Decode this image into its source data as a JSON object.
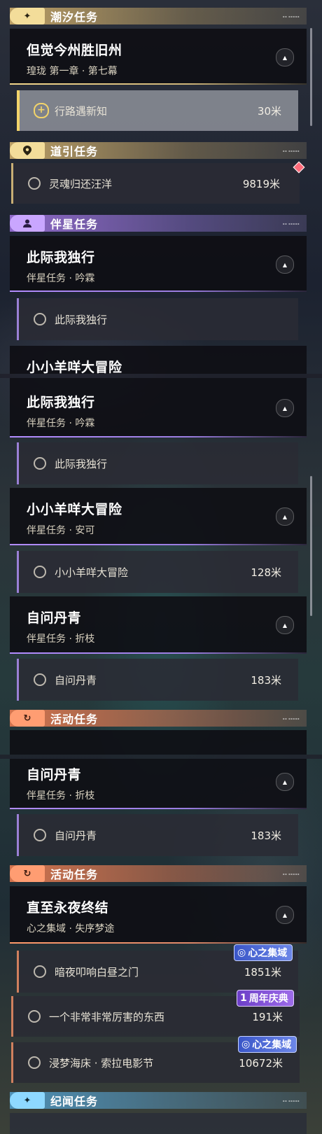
{
  "seg1": {
    "tide_header": "潮汐任务",
    "tide_card": {
      "title": "但觉今州胜旧州",
      "subtitle": "瑝珑 第一章 · 第七幕"
    },
    "tide_sub": {
      "label": "行路遇新知",
      "distance": "30米"
    },
    "guide_header": "道引任务",
    "guide_sub": {
      "label": "灵魂归还汪洋",
      "distance": "9819米"
    },
    "companion_header": "伴星任务",
    "companion_card": {
      "title": "此际我独行",
      "subtitle": "伴星任务 · 吟霖"
    },
    "companion_sub": {
      "label": "此际我独行"
    },
    "partial_title": "小小羊咩大冒险"
  },
  "seg2": {
    "card1": {
      "title": "此际我独行",
      "subtitle": "伴星任务 · 吟霖"
    },
    "sub1": {
      "label": "此际我独行"
    },
    "card2": {
      "title": "小小羊咩大冒险",
      "subtitle": "伴星任务 · 安可"
    },
    "sub2": {
      "label": "小小羊咩大冒险",
      "distance": "128米"
    },
    "card3": {
      "title": "自问丹青",
      "subtitle": "伴星任务 · 折枝"
    },
    "sub3": {
      "label": "自问丹青",
      "distance": "183米"
    },
    "event_header": "活动任务"
  },
  "seg3": {
    "card1": {
      "title": "自问丹青",
      "subtitle": "伴星任务 · 折枝"
    },
    "sub1": {
      "label": "自问丹青",
      "distance": "183米"
    },
    "event_header": "活动任务",
    "event_card": {
      "title": "直至永夜终结",
      "subtitle": "心之集域 · 失序梦途"
    },
    "event_sub1": {
      "label": "暗夜叩响白昼之门",
      "distance": "1851米",
      "badge": "心之集域"
    },
    "event_sub2": {
      "label": "一个非常非常厉害的东西",
      "distance": "191米",
      "badge": "周年庆典",
      "badge_num": "1"
    },
    "event_sub3": {
      "label": "浸梦海床 · 索拉电影节",
      "distance": "10672米",
      "badge": "心之集域"
    },
    "lore_header": "纪闻任务"
  },
  "colors": {
    "tide": "#f3dd9a",
    "companion": "#c9a6ff",
    "event": "#ff9d72",
    "lore": "#8ed8ff"
  },
  "icons": [
    "sparkle-icon",
    "location-pin-icon",
    "person-icon",
    "event-swirl-icon",
    "collapse-up-icon",
    "plus-circle-icon",
    "circle-outline-icon",
    "red-diamond-icon",
    "swirl-badge-icon"
  ]
}
